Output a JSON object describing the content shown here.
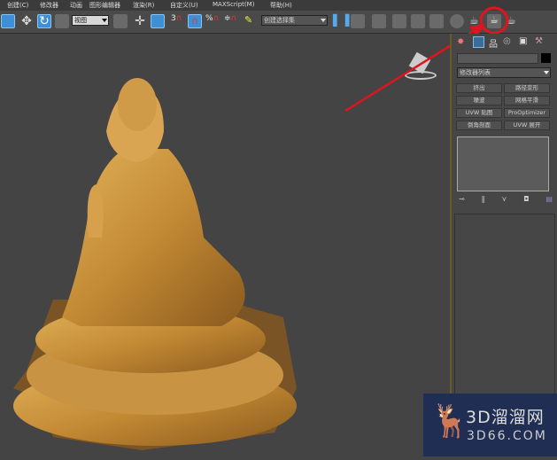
{
  "menu": [
    "创建(C)",
    "修改器",
    "动画",
    "图形编辑器",
    "渲染(R)",
    "自定义(U)",
    "MAXScript(M)",
    "帮助(H)"
  ],
  "toolbar": {
    "view_select": "视图",
    "snap_angle_label": "3",
    "named_selection": "创建选择集"
  },
  "panel": {
    "modifier_list": "修改器列表",
    "buttons": [
      "挤出",
      "路径变形",
      "噪波",
      "网格平滑",
      "UVW 贴图",
      "ProOptimizer",
      "倒角剖面",
      "UVW 展开"
    ]
  },
  "annotation": {
    "color": "#e0141e",
    "target": "teapot-render-icon"
  },
  "watermark": {
    "brand": "3D溜溜网",
    "url": "3D66.COM"
  }
}
